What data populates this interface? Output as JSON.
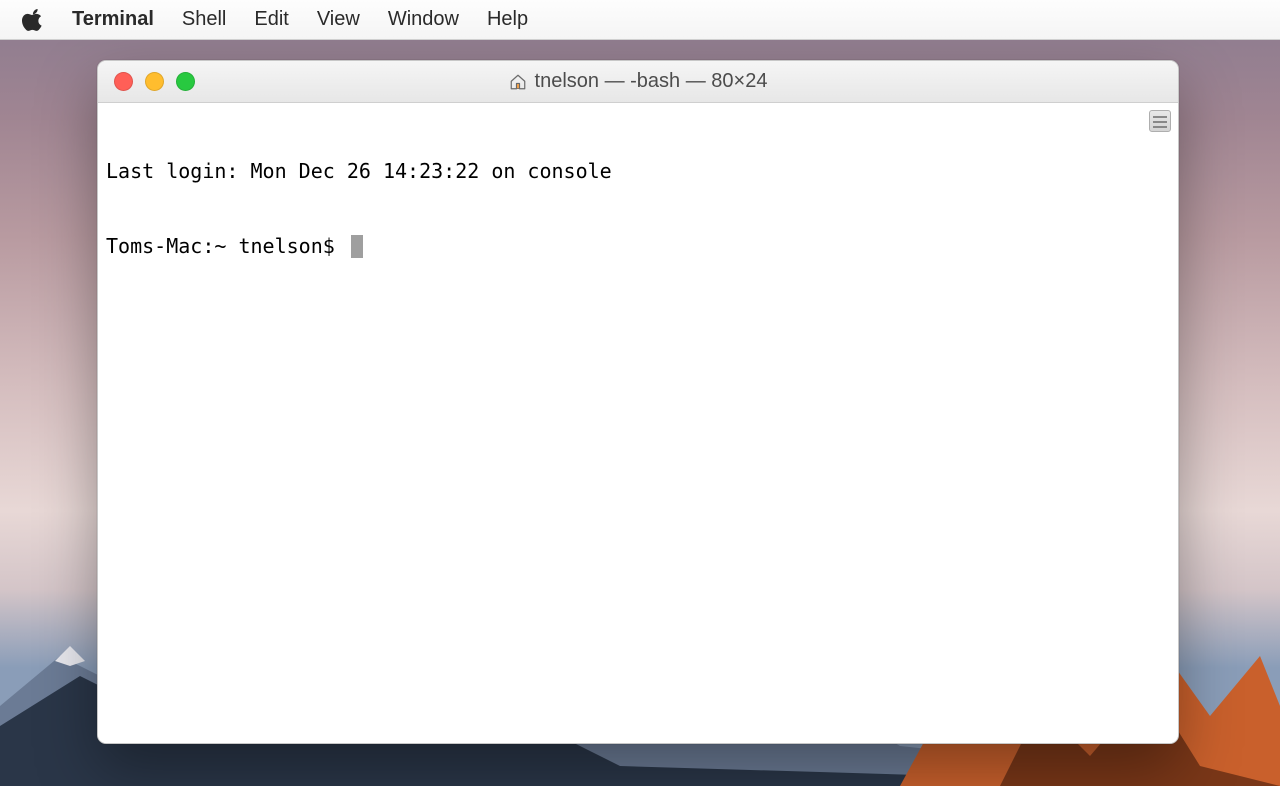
{
  "menubar": {
    "app_name": "Terminal",
    "items": [
      "Shell",
      "Edit",
      "View",
      "Window",
      "Help"
    ]
  },
  "window": {
    "title": "tnelson — -bash — 80×24"
  },
  "terminal": {
    "last_login": "Last login: Mon Dec 26 14:23:22 on console",
    "prompt": "Toms-Mac:~ tnelson$ "
  }
}
